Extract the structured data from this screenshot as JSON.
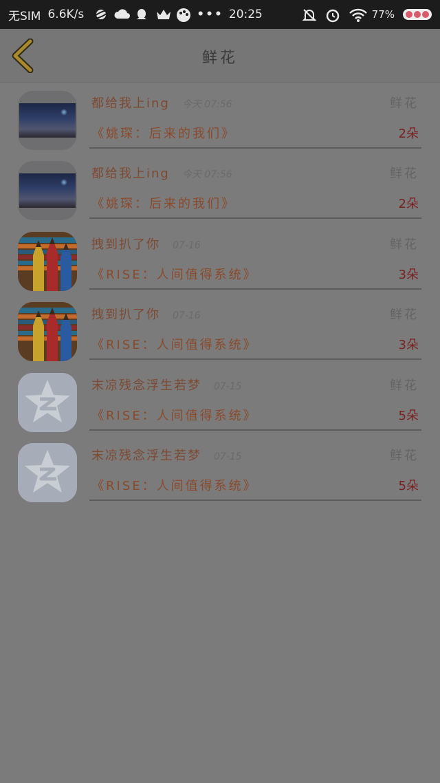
{
  "status_bar": {
    "carrier": "无SIM",
    "speed": "6.6K/s",
    "time": "20:25",
    "battery": "77%"
  },
  "header": {
    "title": "鲜花"
  },
  "rows": [
    {
      "name": "都给我上ing",
      "time": "今天 07:56",
      "gift": "鲜花",
      "work": "《姚琛：后来的我们》",
      "count": "2朵",
      "avatar": "night-sky"
    },
    {
      "name": "都给我上ing",
      "time": "今天 07:56",
      "gift": "鲜花",
      "work": "《姚琛：后来的我们》",
      "count": "2朵",
      "avatar": "night-sky"
    },
    {
      "name": "拽到扒了你",
      "time": "07-16",
      "gift": "鲜花",
      "work": "《RISE：人间值得系统》",
      "count": "3朵",
      "avatar": "pencils"
    },
    {
      "name": "拽到扒了你",
      "time": "07-16",
      "gift": "鲜花",
      "work": "《RISE：人间值得系统》",
      "count": "3朵",
      "avatar": "pencils"
    },
    {
      "name": "末凉残念浮生若梦",
      "time": "07-15",
      "gift": "鲜花",
      "work": "《RISE：人间值得系统》",
      "count": "5朵",
      "avatar": "qq-star"
    },
    {
      "name": "末凉残念浮生若梦",
      "time": "07-15",
      "gift": "鲜花",
      "work": "《RISE：人间值得系统》",
      "count": "5朵",
      "avatar": "qq-star"
    }
  ],
  "colors": {
    "overlay": "#7b7b7b",
    "back_arrow": "#c9a43a"
  }
}
